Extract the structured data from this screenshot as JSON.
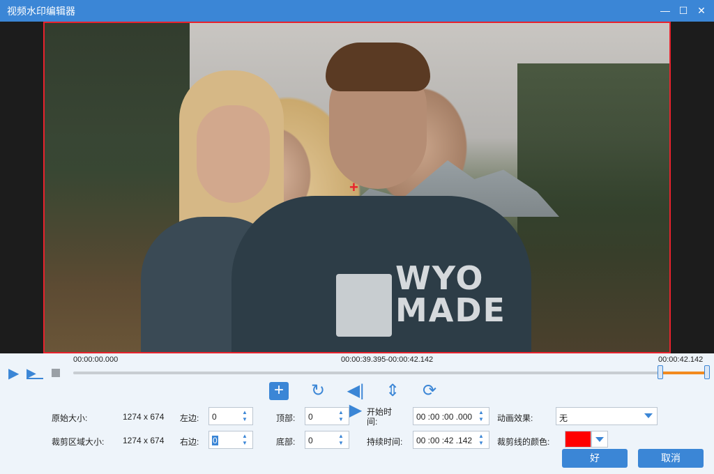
{
  "window": {
    "title": "视频水印编辑器",
    "min_icon": "minimize-icon",
    "max_icon": "maximize-icon",
    "close_icon": "close-icon"
  },
  "video": {
    "shirt_text_line1": "WYO",
    "shirt_text_line2": "MADE"
  },
  "timeline": {
    "start_time": "00:00:00.000",
    "selection_range": "00:00:39.395-00:00:42.142",
    "end_time": "00:00:42.142",
    "selection_start_fraction": 0.934,
    "selection_end_fraction": 1.0
  },
  "toolbar": {
    "add_icon": "add-icon",
    "rotate_icon": "rotate-icon",
    "flip_h_icon": "flip-horizontal-icon",
    "flip_v_icon": "flip-vertical-icon",
    "reset_icon": "reset-icon"
  },
  "fields": {
    "original_size_label": "原始大小:",
    "original_size_value": "1274 x 674",
    "crop_size_label": "裁剪区域大小:",
    "crop_size_value": "1274 x 674",
    "left_label": "左边:",
    "left_value": "0",
    "right_label": "右边:",
    "right_value": "0",
    "top_label": "顶部:",
    "top_value": "0",
    "bottom_label": "底部:",
    "bottom_value": "0",
    "start_time_label_1": "开始时",
    "start_time_label_2": "间:",
    "start_time_value": "00 :00 :00 .000",
    "duration_label": "持续时间:",
    "duration_value": "00 :00 :42 .142",
    "animation_label": "动画效果:",
    "animation_value": "无",
    "crop_color_label": "裁剪线的颜色:",
    "crop_color": "#ff0000"
  },
  "buttons": {
    "ok": "好",
    "cancel": "取消"
  }
}
